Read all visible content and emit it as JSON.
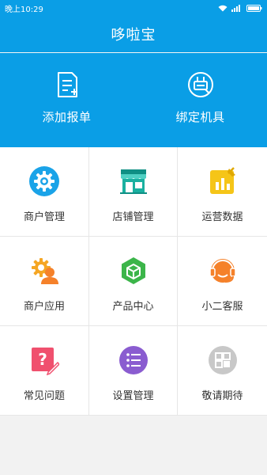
{
  "status_bar": {
    "time": "晚上10:29",
    "battery_icon": "battery-icon",
    "wifi_icon": "wifi-icon"
  },
  "header": {
    "title": "哆啦宝"
  },
  "hero": {
    "items": [
      {
        "label": "添加报单",
        "icon": "add-order-icon"
      },
      {
        "label": "绑定机具",
        "icon": "bind-device-icon"
      }
    ]
  },
  "grid": {
    "items": [
      {
        "label": "商户管理",
        "icon": "gear-icon",
        "color": "#1aa3e8"
      },
      {
        "label": "店铺管理",
        "icon": "store-icon",
        "color": "#1ab0a0"
      },
      {
        "label": "运营数据",
        "icon": "data-chart-icon",
        "color": "#f5c518"
      },
      {
        "label": "商户应用",
        "icon": "merchant-app-icon",
        "color": "#f5a623"
      },
      {
        "label": "产品中心",
        "icon": "cube-icon",
        "color": "#3cb54a"
      },
      {
        "label": "小二客服",
        "icon": "headset-icon",
        "color": "#f5812a"
      },
      {
        "label": "常见问题",
        "icon": "question-icon",
        "color": "#f0506e"
      },
      {
        "label": "设置管理",
        "icon": "list-settings-icon",
        "color": "#8a5cd0"
      },
      {
        "label": "敬请期待",
        "icon": "coming-soon-icon",
        "color": "#c8c8c8"
      }
    ]
  }
}
